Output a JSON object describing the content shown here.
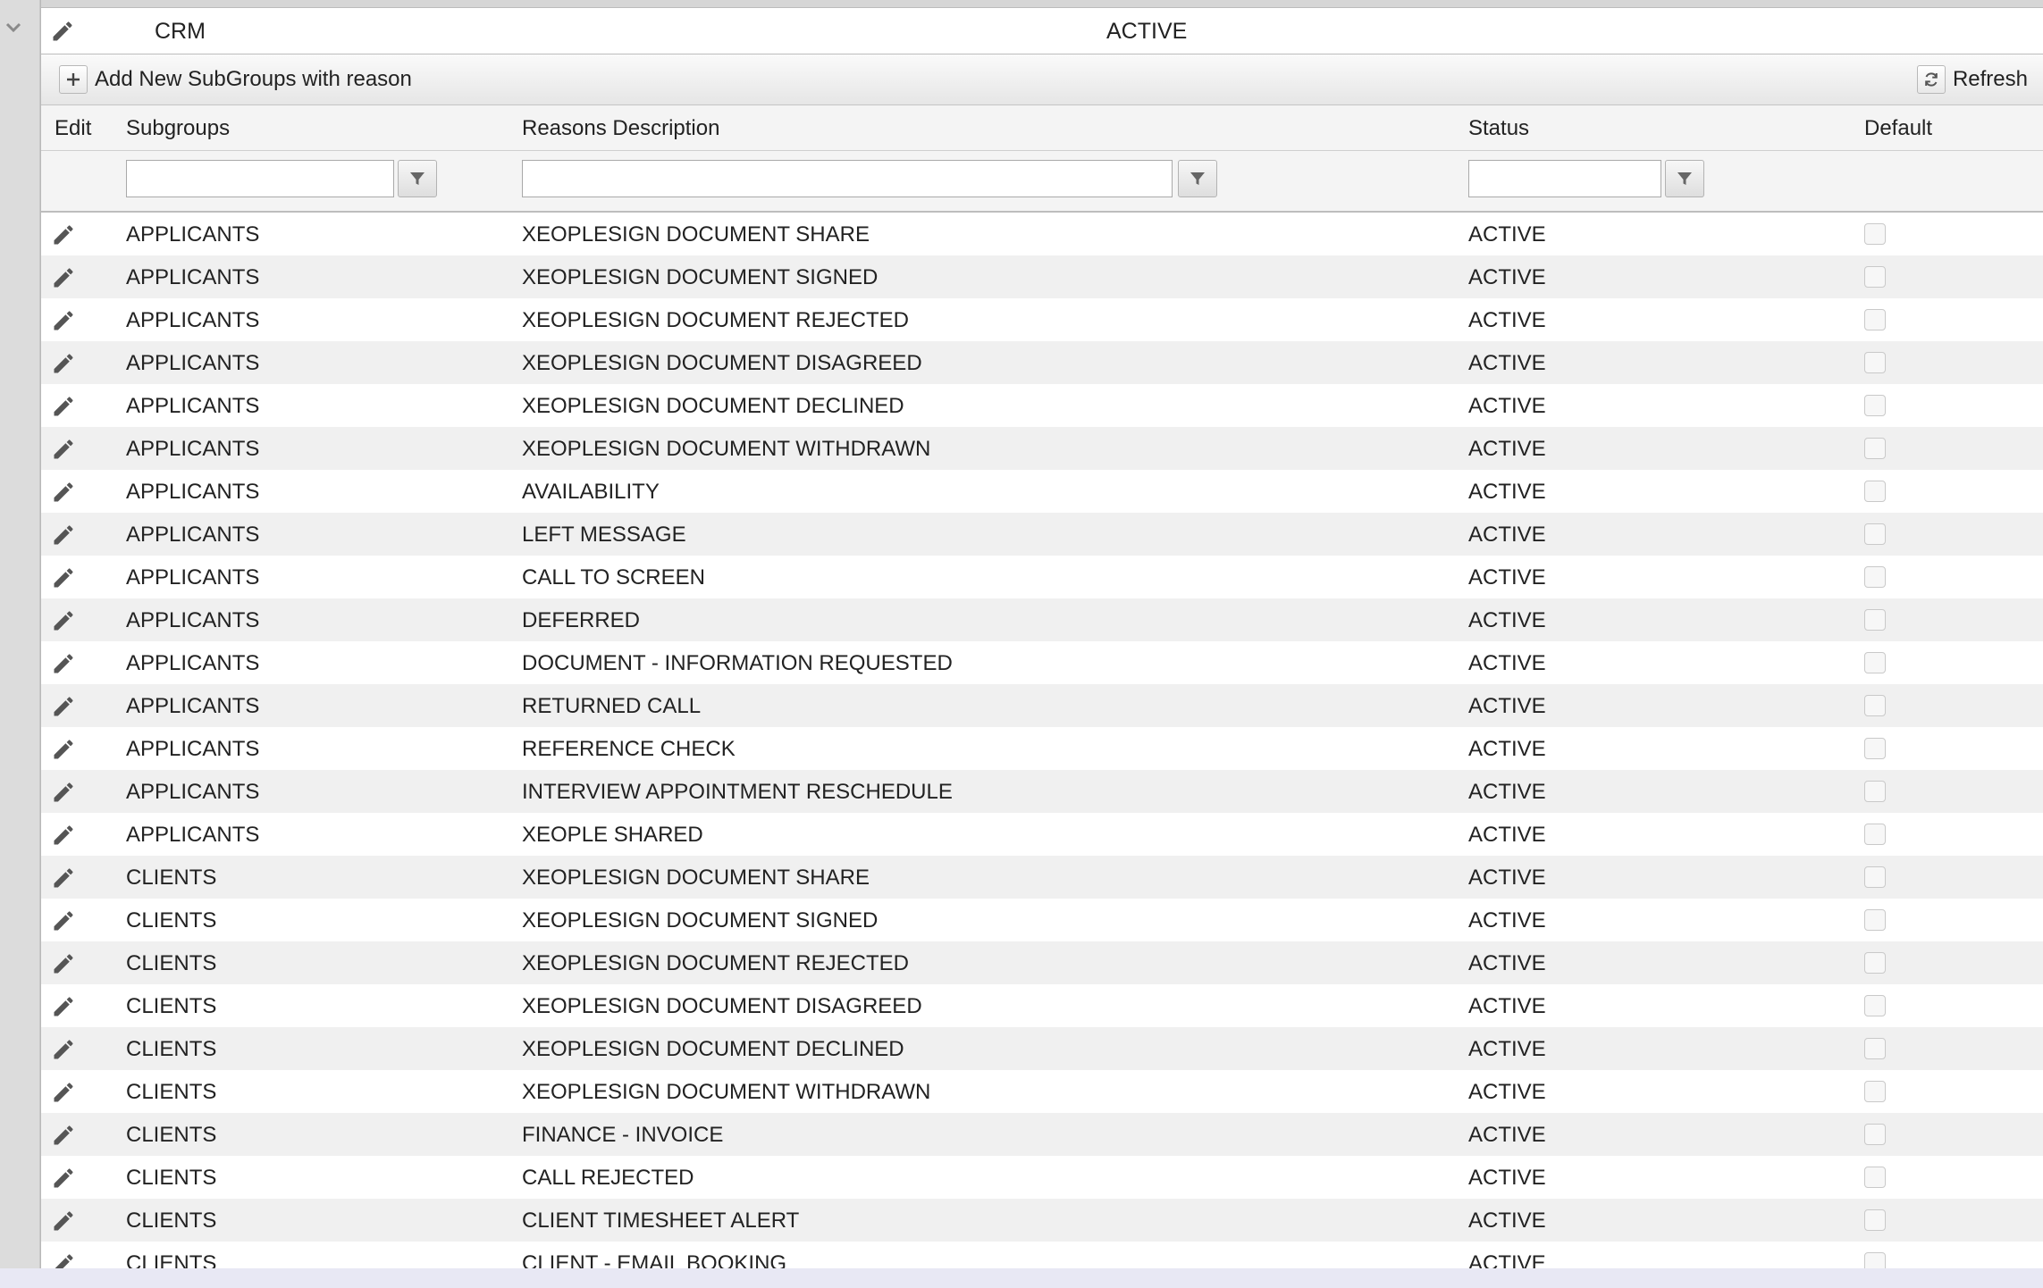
{
  "parent": {
    "group": "CRM",
    "status": "ACTIVE"
  },
  "toolbar": {
    "add_label": "Add New SubGroups with reason",
    "refresh_label": "Refresh"
  },
  "columns": {
    "edit": "Edit",
    "subgroups": "Subgroups",
    "reasons": "Reasons Description",
    "status": "Status",
    "default": "Default"
  },
  "filters": {
    "subgroups": "",
    "reasons": "",
    "status": ""
  },
  "rows": [
    {
      "subgroup": "APPLICANTS",
      "reason": "XEOPLESIGN DOCUMENT SHARE",
      "status": "ACTIVE",
      "default": false
    },
    {
      "subgroup": "APPLICANTS",
      "reason": "XEOPLESIGN DOCUMENT SIGNED",
      "status": "ACTIVE",
      "default": false
    },
    {
      "subgroup": "APPLICANTS",
      "reason": "XEOPLESIGN DOCUMENT REJECTED",
      "status": "ACTIVE",
      "default": false
    },
    {
      "subgroup": "APPLICANTS",
      "reason": "XEOPLESIGN DOCUMENT DISAGREED",
      "status": "ACTIVE",
      "default": false
    },
    {
      "subgroup": "APPLICANTS",
      "reason": "XEOPLESIGN DOCUMENT DECLINED",
      "status": "ACTIVE",
      "default": false
    },
    {
      "subgroup": "APPLICANTS",
      "reason": "XEOPLESIGN DOCUMENT WITHDRAWN",
      "status": "ACTIVE",
      "default": false
    },
    {
      "subgroup": "APPLICANTS",
      "reason": "AVAILABILITY",
      "status": "ACTIVE",
      "default": false
    },
    {
      "subgroup": "APPLICANTS",
      "reason": "LEFT MESSAGE",
      "status": "ACTIVE",
      "default": false
    },
    {
      "subgroup": "APPLICANTS",
      "reason": "CALL TO SCREEN",
      "status": "ACTIVE",
      "default": false
    },
    {
      "subgroup": "APPLICANTS",
      "reason": "DEFERRED",
      "status": "ACTIVE",
      "default": false
    },
    {
      "subgroup": "APPLICANTS",
      "reason": "DOCUMENT - INFORMATION REQUESTED",
      "status": "ACTIVE",
      "default": false
    },
    {
      "subgroup": "APPLICANTS",
      "reason": "RETURNED CALL",
      "status": "ACTIVE",
      "default": false
    },
    {
      "subgroup": "APPLICANTS",
      "reason": "REFERENCE CHECK",
      "status": "ACTIVE",
      "default": false
    },
    {
      "subgroup": "APPLICANTS",
      "reason": "INTERVIEW APPOINTMENT RESCHEDULE",
      "status": "ACTIVE",
      "default": false
    },
    {
      "subgroup": "APPLICANTS",
      "reason": "XEOPLE SHARED",
      "status": "ACTIVE",
      "default": false
    },
    {
      "subgroup": "CLIENTS",
      "reason": "XEOPLESIGN DOCUMENT SHARE",
      "status": "ACTIVE",
      "default": false
    },
    {
      "subgroup": "CLIENTS",
      "reason": "XEOPLESIGN DOCUMENT SIGNED",
      "status": "ACTIVE",
      "default": false
    },
    {
      "subgroup": "CLIENTS",
      "reason": "XEOPLESIGN DOCUMENT REJECTED",
      "status": "ACTIVE",
      "default": false
    },
    {
      "subgroup": "CLIENTS",
      "reason": "XEOPLESIGN DOCUMENT DISAGREED",
      "status": "ACTIVE",
      "default": false
    },
    {
      "subgroup": "CLIENTS",
      "reason": "XEOPLESIGN DOCUMENT DECLINED",
      "status": "ACTIVE",
      "default": false
    },
    {
      "subgroup": "CLIENTS",
      "reason": "XEOPLESIGN DOCUMENT WITHDRAWN",
      "status": "ACTIVE",
      "default": false
    },
    {
      "subgroup": "CLIENTS",
      "reason": "FINANCE - INVOICE",
      "status": "ACTIVE",
      "default": false
    },
    {
      "subgroup": "CLIENTS",
      "reason": "CALL REJECTED",
      "status": "ACTIVE",
      "default": false
    },
    {
      "subgroup": "CLIENTS",
      "reason": "CLIENT TIMESHEET ALERT",
      "status": "ACTIVE",
      "default": false
    },
    {
      "subgroup": "CLIENTS",
      "reason": "CLIENT - EMAIL BOOKING",
      "status": "ACTIVE",
      "default": false
    }
  ],
  "icons": {
    "collapse": "chevron-down-icon",
    "edit": "pencil-icon",
    "add": "plus-icon",
    "refresh": "refresh-icon",
    "filter": "filter-icon"
  },
  "colors": {
    "row_alt": "#f0f0f0",
    "header_bg": "#f4f4f4",
    "gutter_bg": "#dcdcdc"
  }
}
